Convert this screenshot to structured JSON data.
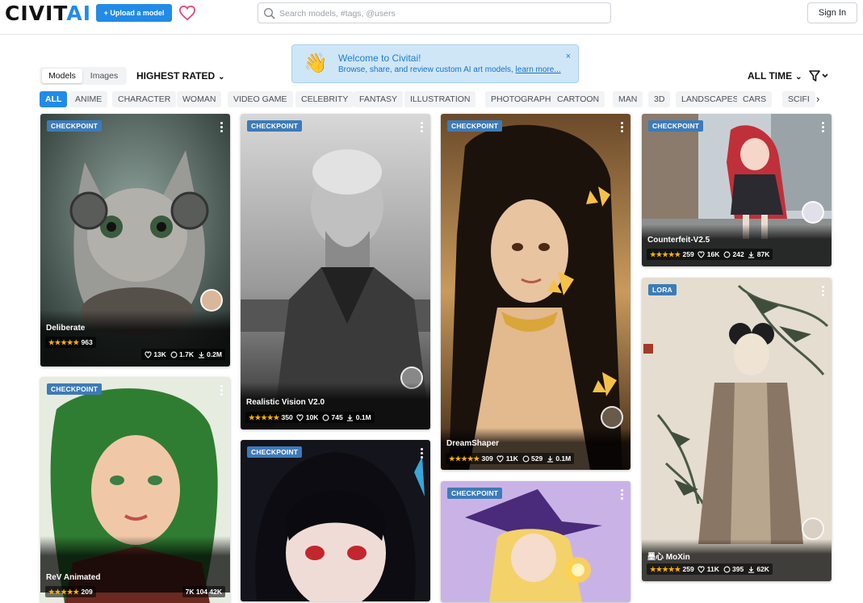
{
  "header": {
    "logo_main": "CIVIT",
    "logo_accent": "AI",
    "upload_label": "+ Upload a model",
    "search_placeholder": "Search models, #tags, @users",
    "signin_label": "Sign In"
  },
  "toolbar": {
    "tabs": [
      "Models",
      "Images"
    ],
    "sort_label": "HIGHEST RATED",
    "period_label": "ALL TIME"
  },
  "welcome": {
    "emoji": "👋",
    "title": "Welcome to Civitai!",
    "desc": "Browse, share, and review custom AI art models, ",
    "link": "learn more...",
    "close": "×"
  },
  "tags": [
    "ALL",
    "ANIME",
    "CHARACTER",
    "WOMAN",
    "VIDEO GAME",
    "CELEBRITY",
    "FANTASY",
    "ILLUSTRATION",
    "PHOTOGRAPHY",
    "CARTOON",
    "MAN",
    "3D",
    "LANDSCAPES",
    "CARS",
    "SCIFI"
  ],
  "colors": {
    "accent": "#228be6",
    "badge": "#3d7bb8",
    "star": "#fab005"
  },
  "cards": [
    {
      "badge": "CHECKPOINT",
      "name": "Deliberate",
      "rating": "963",
      "likes": "13K",
      "comments": "1.7K",
      "downloads": "0.2M"
    },
    {
      "badge": "CHECKPOINT",
      "name": "ReV Animated",
      "rating": "209",
      "likes": "7K",
      "comments": "104",
      "downloads": "42K"
    },
    {
      "badge": "CHECKPOINT",
      "name": "Realistic Vision V2.0",
      "rating": "350",
      "likes": "10K",
      "comments": "745",
      "downloads": "0.1M"
    },
    {
      "badge": "CHECKPOINT",
      "name": "",
      "rating": "",
      "likes": "",
      "comments": "",
      "downloads": ""
    },
    {
      "badge": "CHECKPOINT",
      "name": "DreamShaper",
      "rating": "309",
      "likes": "11K",
      "comments": "529",
      "downloads": "0.1M"
    },
    {
      "badge": "CHECKPOINT",
      "name": "",
      "rating": "",
      "likes": "",
      "comments": "",
      "downloads": ""
    },
    {
      "badge": "CHECKPOINT",
      "name": "Counterfeit-V2.5",
      "rating": "259",
      "likes": "16K",
      "comments": "242",
      "downloads": "87K"
    },
    {
      "badge": "LORA",
      "name": "墨心 MoXin",
      "rating": "259",
      "likes": "11K",
      "comments": "395",
      "downloads": "62K"
    }
  ],
  "stars": "★★★★★"
}
